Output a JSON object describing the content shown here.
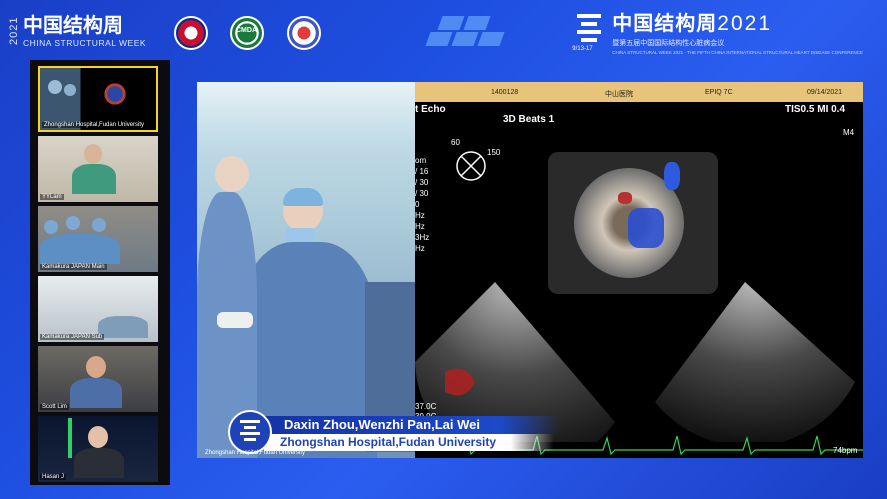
{
  "header": {
    "left_year": "2021",
    "left_title_cn": "中国结构周",
    "left_title_en": "CHINA STRUCTURAL WEEK",
    "logo_center_label": "CMDA",
    "right_title_cn": "中国结构周",
    "right_title_year": "2021",
    "right_sub_cn": "暨第五届中国国际结构性心脏病会议",
    "right_sub_en": "CHINA STRUCTURAL WEEK 2021 · THE FIFTH CHINA INTERNATIONAL STRUCTURAL HEART DISEASE CONFERENCE",
    "right_dates": "9/13-17"
  },
  "sidebar": {
    "tiles": [
      {
        "label": "Zhongshan Hospital,Fudan University"
      },
      {
        "label": "YYLam"
      },
      {
        "label": "Kamakura JAPAN Main"
      },
      {
        "label": "Kamakura JAPAN Sub"
      },
      {
        "label": "Scott Lim"
      },
      {
        "label": "Hasan J"
      }
    ]
  },
  "echo": {
    "header_id": "1400128",
    "header_hospital": "中山医院",
    "header_device": "EPIQ 7C",
    "header_date": "09/14/2021",
    "mode_label": "t Echo",
    "tis_mi": "TIS0.5   MI 0.4",
    "beats_label": "3D Beats 1",
    "angle_60": "60",
    "angle_150": "150",
    "temp1": "37.0C",
    "temp2": "39.9C",
    "bpm": "74bpm",
    "side_m4": "M4",
    "left_partial": [
      "om",
      "/ 16",
      "/ 30",
      "/ 30",
      "0",
      "Hz",
      "Hz",
      "3Hz",
      "Hz"
    ]
  },
  "caption": {
    "names": "Daxin Zhou,Wenzhi Pan,Lai Wei",
    "affiliation": "Zhongshan Hospital,Fudan University",
    "source_label": "Zhongshan Hospital,Fudan University"
  }
}
